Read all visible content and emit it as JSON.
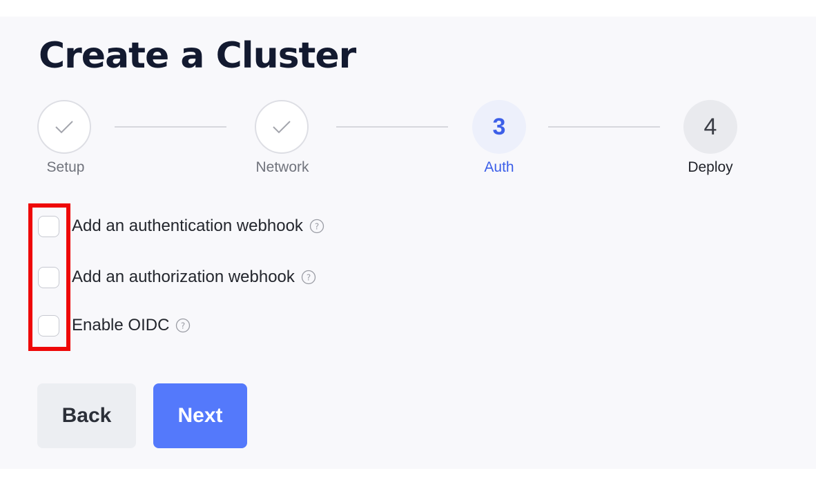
{
  "page": {
    "title": "Create a Cluster"
  },
  "stepper": {
    "steps": [
      {
        "label": "Setup",
        "status": "completed",
        "icon": "checkmark-icon"
      },
      {
        "label": "Network",
        "status": "completed",
        "icon": "checkmark-icon"
      },
      {
        "number": "3",
        "label": "Auth",
        "status": "active"
      },
      {
        "number": "4",
        "label": "Deploy",
        "status": "pending"
      }
    ],
    "colors": {
      "active": "#3c5fe8",
      "completed_border": "#dddee4",
      "pending_bg": "#e9eaee"
    }
  },
  "options": [
    {
      "label": "Add an authentication webhook",
      "checked": false,
      "help_icon": "question-circle-icon"
    },
    {
      "label": "Add an authorization webhook",
      "checked": false,
      "help_icon": "question-circle-icon"
    },
    {
      "label": "Enable OIDC",
      "checked": false,
      "help_icon": "question-circle-icon"
    }
  ],
  "highlight": {
    "color": "#ee0808",
    "target": "option-checkboxes"
  },
  "actions": {
    "back_label": "Back",
    "next_label": "Next",
    "next_color": "#5479fb"
  }
}
